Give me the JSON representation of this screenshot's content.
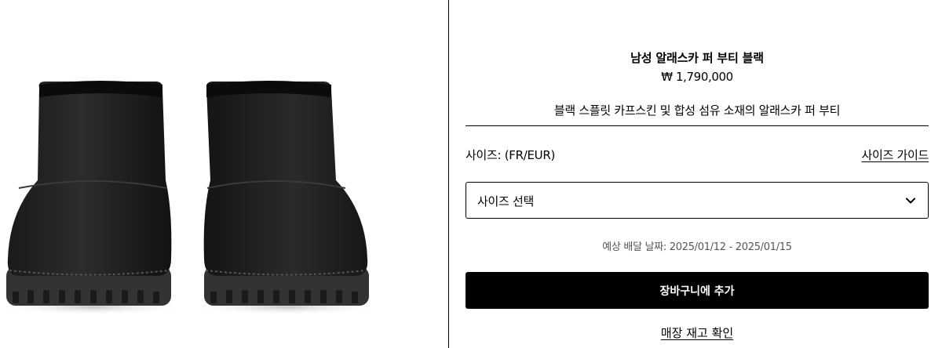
{
  "product": {
    "image_icon": "fur-bootie-pair-photo",
    "title": "남성 알래스카 퍼 부티 블랙",
    "price": "₩ 1,790,000",
    "description": "블랙 스플릿 카프스킨 및 합성 섬유 소재의 알래스카 퍼 부티"
  },
  "size": {
    "label": "사이즈: (FR/EUR)",
    "guide_link": "사이즈 가이드",
    "select_value": "사이즈 선택",
    "chevron_icon": "chevron-down-icon"
  },
  "delivery": {
    "text": "예상 배달 날짜: 2025/01/12 - 2025/01/15"
  },
  "actions": {
    "add_to_cart": "장바구니에 추가",
    "check_stock": "매장 재고 확인"
  },
  "colors": {
    "primary": "#000000",
    "background": "#ffffff",
    "muted_text": "#555555"
  }
}
